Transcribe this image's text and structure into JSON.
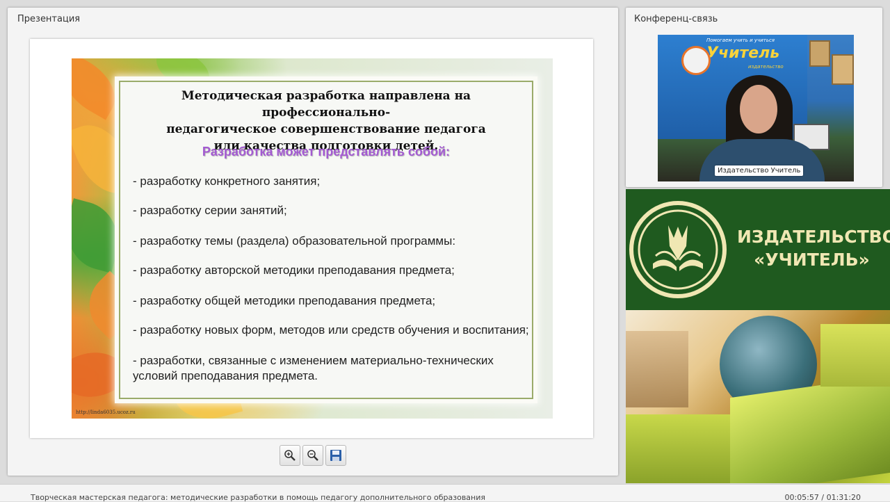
{
  "presentation": {
    "title": "Презентация",
    "slide": {
      "heading_lines": [
        "Методическая разработка направлена на профессионально-",
        "педагогическое совершенствование педагога",
        "или качества подготовки детей."
      ],
      "subheading": "Разработка может представлять собой:",
      "items": [
        "- разработку конкретного занятия;",
        "- разработку серии занятий;",
        "- разработку темы (раздела) образовательной программы:",
        "- разработку авторской методики преподавания предмета;",
        "- разработку общей методики преподавания предмета;",
        "- разработку новых форм, методов или средств обучения и воспитания;",
        "- разработки, связанные с изменением материально-технических условий преподавания предмета."
      ],
      "footer_url": "http://linda6035.ucoz.ru"
    },
    "toolbar": {
      "zoom_in_icon": "zoom-in-icon",
      "zoom_out_icon": "zoom-out-icon",
      "save_icon": "save-icon"
    }
  },
  "conference": {
    "title": "Конференц-связь",
    "video_label": "Издательство Учитель",
    "banner_lines": [
      "Помогаем учить и учиться",
      "Учитель",
      "издательство"
    ]
  },
  "brand": {
    "name_line1": "ИЗДАТЕЛЬСТВО",
    "name_line2": "«УЧИТЕЛЬ»",
    "colors": {
      "background": "#1f5a1f",
      "text": "#f0e7b3"
    }
  },
  "status_bar": {
    "title": "Творческая мастерская педагога: методические разработки в помощь педагогу дополнительного образования",
    "time": "00:05:57 / 01:31:20"
  }
}
